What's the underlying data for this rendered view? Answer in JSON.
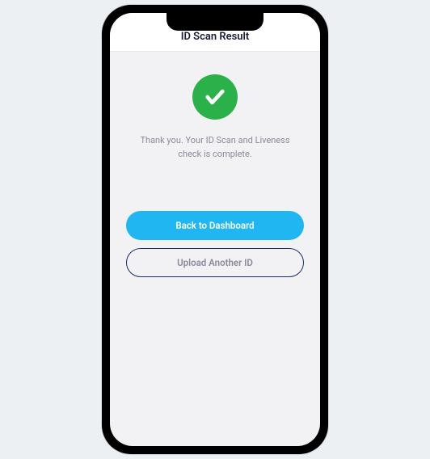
{
  "header": {
    "title": "ID Scan Result"
  },
  "result": {
    "message": "Thank you. Your ID Scan and Liveness check is complete."
  },
  "buttons": {
    "primary": "Back to Dashboard",
    "secondary": "Upload Another ID"
  }
}
